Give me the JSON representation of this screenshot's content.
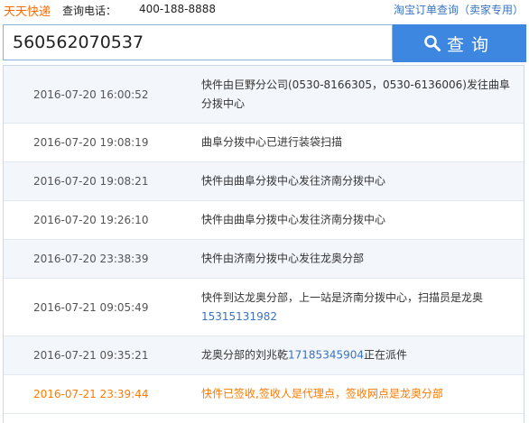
{
  "header": {
    "brand": "天天快递",
    "phone_label": "查询电话：",
    "phone_number": "400-188-8888",
    "taobao_link": "淘宝订单查询（卖家专用）"
  },
  "search": {
    "value": "560562070537",
    "button_label": "查询",
    "icon": "search-icon"
  },
  "tracking": [
    {
      "time": "2016-07-20 16:00:52",
      "pre": "快件由巨野分公司(0530-8166305，0530-6136006)发往曲阜分拨中心",
      "tel": "",
      "post": ""
    },
    {
      "time": "2016-07-20 19:08:19",
      "pre": "曲阜分拨中心已进行装袋扫描",
      "tel": "",
      "post": ""
    },
    {
      "time": "2016-07-20 19:08:21",
      "pre": "快件由曲阜分拨中心发往济南分拨中心",
      "tel": "",
      "post": ""
    },
    {
      "time": "2016-07-20 19:26:10",
      "pre": "快件由曲阜分拨中心发往济南分拨中心",
      "tel": "",
      "post": ""
    },
    {
      "time": "2016-07-20 23:38:39",
      "pre": "快件由济南分拨中心发往龙奥分部",
      "tel": "",
      "post": ""
    },
    {
      "time": "2016-07-21 09:05:49",
      "pre": "快件到达龙奥分部，上一站是济南分拨中心，扫描员是龙奥",
      "tel": "15315131982",
      "post": ""
    },
    {
      "time": "2016-07-21 09:35:21",
      "pre": "龙奥分部的刘兆乾",
      "tel": "17185345904",
      "post": "正在派件"
    },
    {
      "time": "2016-07-21 23:39:44",
      "pre": "快件已签收,签收人是代理点，签收网点是龙奥分部",
      "tel": "",
      "post": ""
    }
  ],
  "colors": {
    "brand": "#ff6a00",
    "button": "#3d87e0",
    "link": "#3a73c0",
    "latest": "#ff7a00"
  }
}
